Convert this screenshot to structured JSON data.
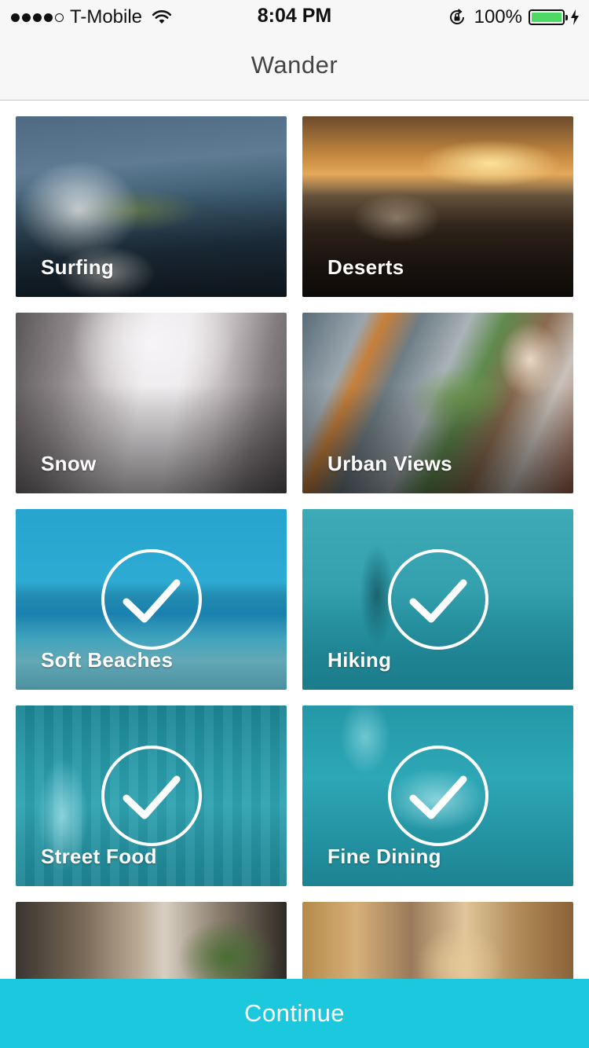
{
  "status_bar": {
    "carrier": "T-Mobile",
    "time": "8:04 PM",
    "battery_percent": "100%",
    "signal_bars_filled": 4,
    "signal_bars_total": 5
  },
  "nav": {
    "title": "Wander"
  },
  "categories": [
    {
      "label": "Surfing",
      "selected": false
    },
    {
      "label": "Deserts",
      "selected": false
    },
    {
      "label": "Snow",
      "selected": false
    },
    {
      "label": "Urban Views",
      "selected": false
    },
    {
      "label": "Soft Beaches",
      "selected": true
    },
    {
      "label": "Hiking",
      "selected": true
    },
    {
      "label": "Street Food",
      "selected": true
    },
    {
      "label": "Fine Dining",
      "selected": true
    },
    {
      "label": "",
      "selected": false
    },
    {
      "label": "",
      "selected": false
    }
  ],
  "footer": {
    "continue_label": "Continue"
  },
  "colors": {
    "accent": "#1bc8dd",
    "selected_tint": "#17b2c4",
    "battery": "#4cd964"
  }
}
